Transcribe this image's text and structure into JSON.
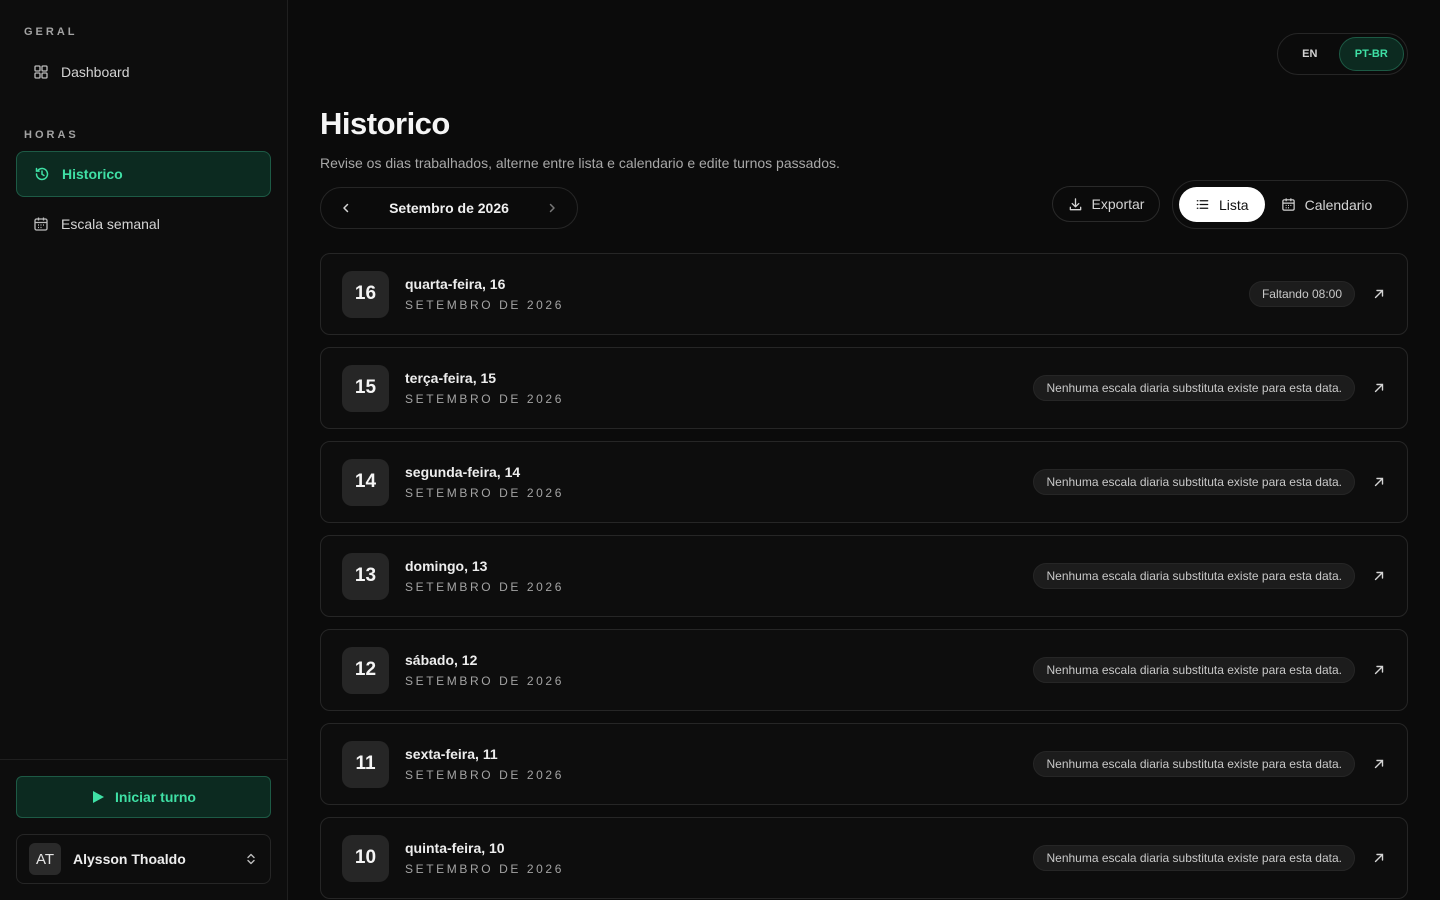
{
  "sidebar": {
    "sections": [
      {
        "label": "GERAL",
        "items": [
          {
            "label": "Dashboard",
            "icon": "grid-icon"
          }
        ]
      },
      {
        "label": "HORAS",
        "items": [
          {
            "label": "Historico",
            "icon": "history-icon",
            "active": true
          },
          {
            "label": "Escala semanal",
            "icon": "calendar-icon"
          }
        ]
      }
    ],
    "start_shift_label": "Iniciar turno",
    "user": {
      "initials": "AT",
      "name": "Alysson Thoaldo"
    }
  },
  "language": {
    "options": [
      "EN",
      "PT-BR"
    ],
    "selected": "PT-BR"
  },
  "header": {
    "title": "Historico",
    "subtitle": "Revise os dias trabalhados, alterne entre lista e calendario e edite turnos passados."
  },
  "month_nav": {
    "label": "Setembro de 2026"
  },
  "toolbar": {
    "export_label": "Exportar",
    "views": [
      "Lista",
      "Calendario"
    ],
    "active_view": "Lista"
  },
  "days": [
    {
      "num": "16",
      "title": "quarta-feira, 16",
      "month": "SETEMBRO DE 2026",
      "badge": "Faltando 08:00"
    },
    {
      "num": "15",
      "title": "terça-feira, 15",
      "month": "SETEMBRO DE 2026",
      "badge": "Nenhuma escala diaria substituta existe para esta data."
    },
    {
      "num": "14",
      "title": "segunda-feira, 14",
      "month": "SETEMBRO DE 2026",
      "badge": "Nenhuma escala diaria substituta existe para esta data."
    },
    {
      "num": "13",
      "title": "domingo, 13",
      "month": "SETEMBRO DE 2026",
      "badge": "Nenhuma escala diaria substituta existe para esta data."
    },
    {
      "num": "12",
      "title": "sábado, 12",
      "month": "SETEMBRO DE 2026",
      "badge": "Nenhuma escala diaria substituta existe para esta data."
    },
    {
      "num": "11",
      "title": "sexta-feira, 11",
      "month": "SETEMBRO DE 2026",
      "badge": "Nenhuma escala diaria substituta existe para esta data."
    },
    {
      "num": "10",
      "title": "quinta-feira, 10",
      "month": "SETEMBRO DE 2026",
      "badge": "Nenhuma escala diaria substituta existe para esta data."
    }
  ],
  "colors": {
    "accent": "#3fe0a5",
    "accent_bg": "#0c2a20",
    "background": "#0b0b0b"
  }
}
